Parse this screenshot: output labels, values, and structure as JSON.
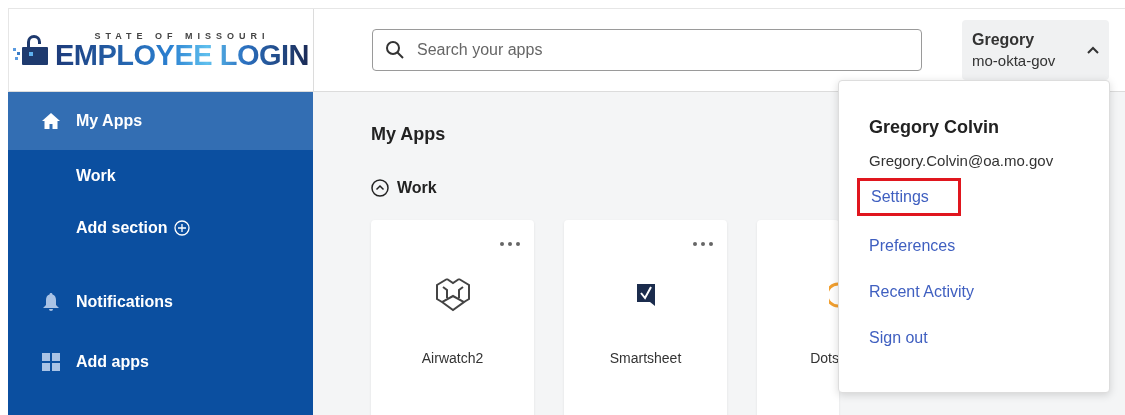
{
  "logo": {
    "overline": "STATE OF MISSOURI",
    "title": "EMPLOYEE LOGIN"
  },
  "search": {
    "placeholder": "Search your apps"
  },
  "user_menu": {
    "name": "Gregory",
    "org": "mo-okta-gov",
    "expanded": true
  },
  "sidebar": {
    "items": [
      {
        "label": "My Apps",
        "selected": true
      },
      {
        "label": "Work",
        "selected": false
      },
      {
        "label": "Add section",
        "selected": false
      },
      {
        "label": "Notifications",
        "selected": false
      },
      {
        "label": "Add apps",
        "selected": false
      }
    ]
  },
  "main": {
    "title": "My Apps",
    "section": {
      "label": "Work",
      "expanded": true
    },
    "apps": [
      {
        "name": "Airwatch2",
        "clipped": false
      },
      {
        "name": "Smartsheet",
        "clipped": false
      },
      {
        "name": "Dots",
        "clipped": true
      }
    ]
  },
  "dropdown": {
    "full_name": "Gregory Colvin",
    "email": "Gregory.Colvin@oa.mo.gov",
    "items": [
      {
        "label": "Settings",
        "highlighted": true
      },
      {
        "label": "Preferences",
        "highlighted": false
      },
      {
        "label": "Recent Activity",
        "highlighted": false
      },
      {
        "label": "Sign out",
        "highlighted": false
      }
    ]
  }
}
